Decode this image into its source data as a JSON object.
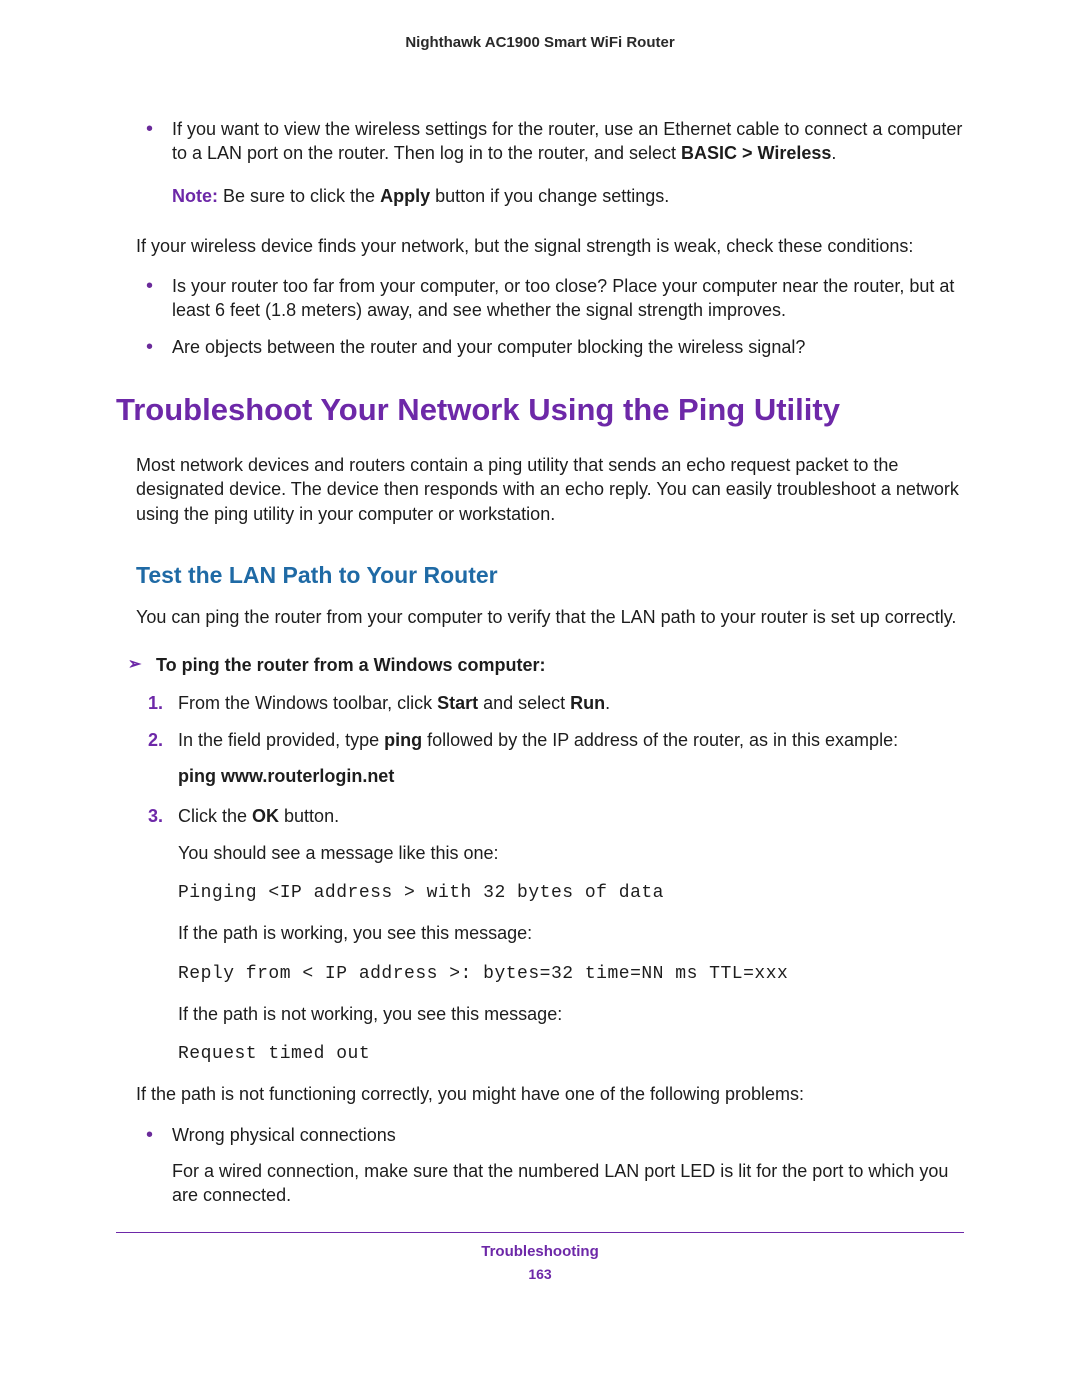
{
  "header": "Nighthawk AC1900 Smart WiFi Router",
  "intro_bullet": {
    "pre": "If you want to view the wireless settings for the router, use an Ethernet cable to connect a computer to a LAN port on the router. Then log in to the router, and select ",
    "bold": "BASIC > Wireless",
    "post": "."
  },
  "note": {
    "label": "Note:",
    "pre": "  Be sure to click the ",
    "bold": "Apply",
    "post": " button if you change settings."
  },
  "weak_signal_intro": "If your wireless device finds your network, but the signal strength is weak, check these conditions:",
  "signal_bullets": [
    "Is your router too far from your computer, or too close? Place your computer near the router, but at least 6 feet (1.8 meters) away, and see whether the signal strength improves.",
    "Are objects between the router and your computer blocking the wireless signal?"
  ],
  "section_title": "Troubleshoot Your Network Using the Ping Utility",
  "section_body": "Most network devices and routers contain a ping utility that sends an echo request packet to the designated device. The device then responds with an echo reply. You can easily troubleshoot a network using the ping utility in your computer or workstation.",
  "subsection_title": "Test the LAN Path to Your Router",
  "subsection_body": "You can ping the router from your computer to verify that the LAN path to your router is set up correctly.",
  "task_heading": "To ping the router from a Windows computer:",
  "steps": {
    "s1": {
      "pre": "From the Windows toolbar, click ",
      "b1": "Start",
      "mid": " and select ",
      "b2": "Run",
      "post": "."
    },
    "s2": {
      "pre": "In the field provided, type ",
      "b1": "ping",
      "post": " followed by the IP address of the router, as in this example:"
    },
    "s2_cmd": "ping www.routerlogin.net",
    "s3": {
      "pre": "Click the ",
      "b1": "OK",
      "post": " button."
    }
  },
  "after_ok": "You should see a message like this one:",
  "mono1": "Pinging <IP address > with 32 bytes of data",
  "path_working": "If the path is working, you see this message:",
  "mono2": "Reply from < IP address >: bytes=32 time=NN ms TTL=xxx",
  "path_not_working": "If the path is not working, you see this message:",
  "mono3": "Request timed out",
  "not_functioning": "If the path is not functioning correctly, you might have one of the following problems:",
  "problem_bullet": "Wrong physical connections",
  "problem_detail": "For a wired connection, make sure that the numbered LAN port LED is lit for the port to which you are connected.",
  "footer_title": "Troubleshooting",
  "footer_page": "163"
}
